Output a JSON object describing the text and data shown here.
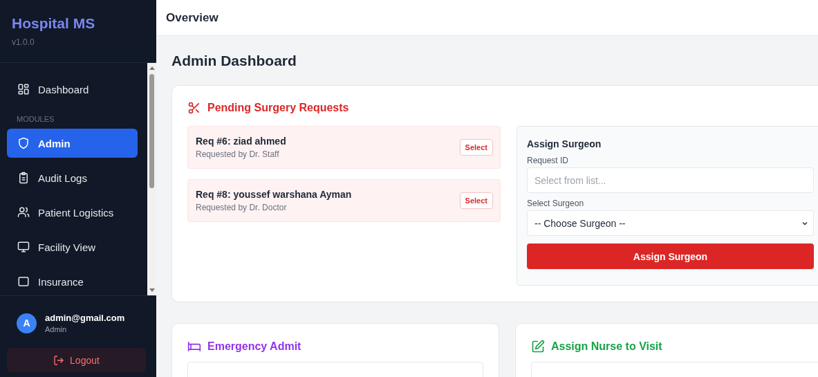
{
  "sidebar": {
    "brand": "Hospital MS",
    "version": "v1.0.0",
    "items": [
      {
        "label": "Dashboard",
        "selected": false
      }
    ],
    "section": "MODULES",
    "modules": [
      {
        "label": "Admin",
        "selected": true
      },
      {
        "label": "Audit Logs",
        "selected": false
      },
      {
        "label": "Patient Logistics",
        "selected": false
      },
      {
        "label": "Facility View",
        "selected": false
      },
      {
        "label": "Insurance",
        "selected": false
      }
    ],
    "user": {
      "avatar": "A",
      "email": "admin@gmail.com",
      "role": "Admin"
    },
    "logout": "Logout"
  },
  "header": {
    "title": "Overview"
  },
  "page_title": "Admin Dashboard",
  "surgery": {
    "title": "Pending Surgery Requests",
    "requests": [
      {
        "title": "Req #6: ziad ahmed",
        "subtitle": "Requested by Dr. Staff",
        "action": "Select"
      },
      {
        "title": "Req #8: youssef warshana Ayman",
        "subtitle": "Requested by Dr. Doctor",
        "action": "Select"
      }
    ],
    "assign": {
      "title": "Assign Surgeon",
      "fields": [
        {
          "label": "Request ID",
          "kind": "input",
          "placeholder": "Select from list..."
        },
        {
          "label": "Select Surgeon",
          "kind": "select",
          "value": "-- Choose Surgeon --"
        }
      ],
      "button": "Assign Surgeon"
    }
  },
  "cards": [
    {
      "title": "Emergency Admit",
      "color": "#9333ea"
    },
    {
      "title": "Assign Nurse to Visit",
      "color": "#16a34a"
    }
  ]
}
